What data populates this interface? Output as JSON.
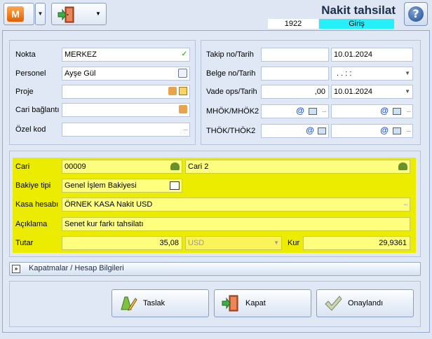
{
  "header": {
    "title": "Nakit tahsilat",
    "doc_code": "1922",
    "doc_state": "Giriş",
    "module_badge": "M",
    "dropdown_arrow": "▼"
  },
  "left_group": {
    "nokta_label": "Nokta",
    "nokta_value": "MERKEZ",
    "personel_label": "Personel",
    "personel_value": "Ayşe Gül",
    "proje_label": "Proje",
    "proje_value": "",
    "cari_baglanti_label": "Cari bağlantı",
    "cari_baglanti_value": "",
    "ozel_kod_label": "Özel kod",
    "ozel_kod_value": ""
  },
  "right_group": {
    "takip_label": "Takip no/Tarih",
    "takip_no": "",
    "takip_tarih": "10.01.2024",
    "belge_label": "Belge no/Tarih",
    "belge_no": "",
    "belge_tarih": ". .   : :",
    "vade_label": "Vade ops/Tarih",
    "vade_ops": ",00",
    "vade_tarih": "10.01.2024",
    "mhok_label": "MHÖK/MHÖK2",
    "thok_label": "THÖK/THÖK2",
    "at_symbol": "@"
  },
  "main_group": {
    "cari_label": "Cari",
    "cari_code": "00009",
    "cari_name": "Cari 2",
    "bakiye_label": "Bakiye tipi",
    "bakiye_value": "Genel İşlem Bakiyesi",
    "kasa_label": "Kasa hesabı",
    "kasa_value": "ÖRNEK KASA Nakit USD",
    "aciklama_label": "Açıklama",
    "aciklama_value": "Senet kur farkı tahsilatı",
    "tutar_label": "Tutar",
    "tutar_value": "35,08",
    "currency_value": "USD",
    "kur_label": "Kur",
    "kur_value": "29,9361"
  },
  "expander": {
    "label": "Kapatmalar / Hesap Bilgileri"
  },
  "buttons": {
    "taslak": "Taslak",
    "kapat": "Kapat",
    "onaylandi": "Onaylandı"
  },
  "icons": {
    "ellipsis": "···",
    "check": "✓",
    "chevron": "▼",
    "expand": "»",
    "help": "?"
  },
  "colors": {
    "highlight": "#fefe7f",
    "zone": "#ecec00",
    "state": "#25f0fa",
    "window": "#dfe8f4"
  }
}
